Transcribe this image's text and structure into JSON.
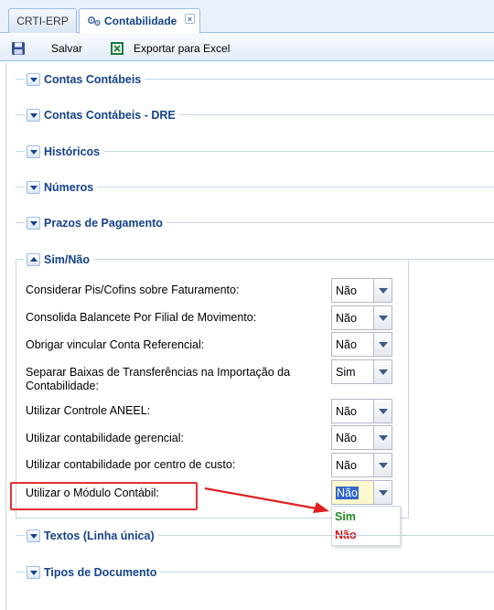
{
  "tabs": [
    {
      "label": "CRTI-ERP"
    },
    {
      "label": "Contabilidade",
      "close": "×"
    }
  ],
  "toolbar": {
    "save_label": "Salvar",
    "excel_label": "Exportar para Excel"
  },
  "sections": [
    {
      "title": "Contas Contábeis",
      "expanded": false
    },
    {
      "title": "Contas Contábeis - DRE",
      "expanded": false
    },
    {
      "title": "Históricos",
      "expanded": false
    },
    {
      "title": "Números",
      "expanded": false
    },
    {
      "title": "Prazos de Pagamento",
      "expanded": false
    },
    {
      "title": "Sim/Não",
      "expanded": true
    },
    {
      "title": "Textos (Linha única)",
      "expanded": false
    },
    {
      "title": "Tipos de Documento",
      "expanded": false
    }
  ],
  "sim_nao_fields": [
    {
      "label": "Considerar Pis/Cofins sobre Faturamento:",
      "value": "Não"
    },
    {
      "label": "Consolida Balancete Por Filial de Movimento:",
      "value": "Não"
    },
    {
      "label": "Obrigar vincular Conta Referencial:",
      "value": "Não"
    },
    {
      "label_line1": "Separar Baixas de Transferências na Importação da",
      "label_line2": "Contabilidade:",
      "value": "Sim"
    },
    {
      "label": "Utilizar Controle ANEEL:",
      "value": "Não"
    },
    {
      "label": "Utilizar contabilidade gerencial:",
      "value": "Não"
    },
    {
      "label": "Utilizar contabilidade por centro de custo:",
      "value": "Não"
    },
    {
      "label": "Utilizar o Módulo Contábil:",
      "value": "Não"
    }
  ],
  "dropdown_options": [
    "Sim",
    "Não"
  ],
  "colors": {
    "accent": "#15428b",
    "highlight": "#e03030",
    "option_sim": "#1f8a1f",
    "option_nao": "#d01010"
  }
}
